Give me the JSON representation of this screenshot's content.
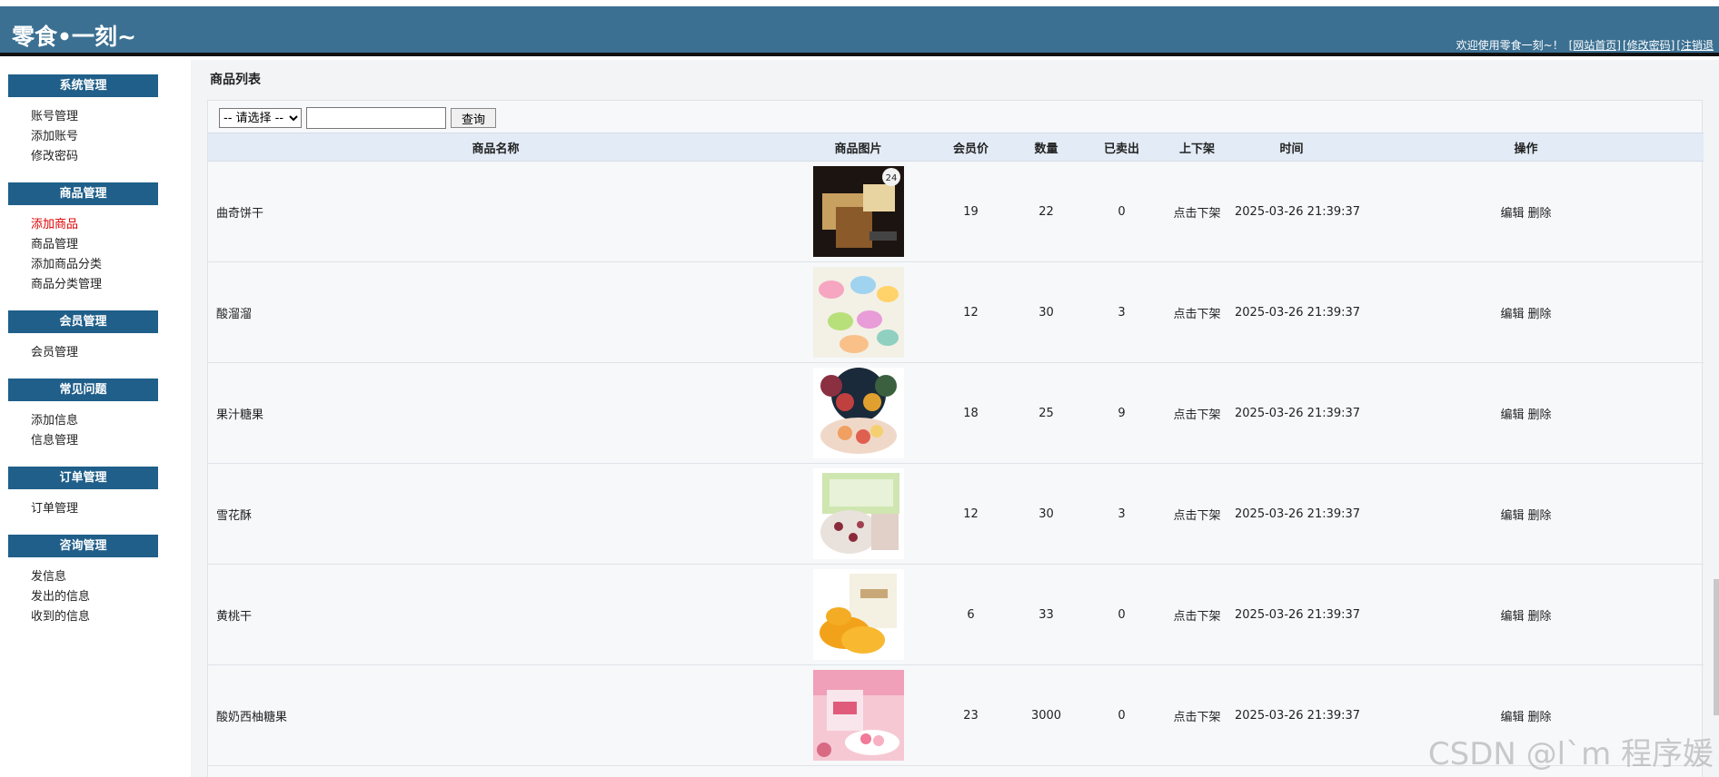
{
  "header": {
    "site_title": "零食•一刻~",
    "welcome": "欢迎使用零食一刻~！",
    "links": [
      "[网站首页]",
      "[修改密码]",
      "[注销退"
    ]
  },
  "sidebar": {
    "groups": [
      {
        "title": "系统管理",
        "items": [
          "账号管理",
          "添加账号",
          "修改密码"
        ]
      },
      {
        "title": "商品管理",
        "items": [
          "添加商品",
          "商品管理",
          "添加商品分类",
          "商品分类管理"
        ]
      },
      {
        "title": "会员管理",
        "items": [
          "会员管理"
        ]
      },
      {
        "title": "常见问题",
        "items": [
          "添加信息",
          "信息管理"
        ]
      },
      {
        "title": "订单管理",
        "items": [
          "订单管理"
        ]
      },
      {
        "title": "咨询管理",
        "items": [
          "发信息",
          "发出的信息",
          "收到的信息"
        ]
      }
    ],
    "active_item": "添加商品"
  },
  "main": {
    "title": "商品列表",
    "search": {
      "select_value": "-- 请选择 --",
      "input_value": "",
      "button_label": "查询"
    },
    "table": {
      "headers": [
        "商品名称",
        "商品图片",
        "会员价",
        "数量",
        "已卖出",
        "上下架",
        "时间",
        "操作"
      ],
      "rows": [
        {
          "name": "曲奇饼干",
          "price": "19",
          "qty": "22",
          "sold": "0",
          "shelf": "点击下架",
          "time": "2025-03-26 21:39:37",
          "edit": "编辑",
          "delete": "删除",
          "image": "cookie-product-image"
        },
        {
          "name": "酸溜溜",
          "price": "12",
          "qty": "30",
          "sold": "3",
          "shelf": "点击下架",
          "time": "2025-03-26 21:39:37",
          "edit": "编辑",
          "delete": "删除",
          "image": "sour-candy-product-image"
        },
        {
          "name": "果汁糖果",
          "price": "18",
          "qty": "25",
          "sold": "9",
          "shelf": "点击下架",
          "time": "2025-03-26 21:39:37",
          "edit": "编辑",
          "delete": "删除",
          "image": "juice-candy-product-image"
        },
        {
          "name": "雪花酥",
          "price": "12",
          "qty": "30",
          "sold": "3",
          "shelf": "点击下架",
          "time": "2025-03-26 21:39:37",
          "edit": "编辑",
          "delete": "删除",
          "image": "snowflake-crisp-product-image"
        },
        {
          "name": "黄桃干",
          "price": "6",
          "qty": "33",
          "sold": "0",
          "shelf": "点击下架",
          "time": "2025-03-26 21:39:37",
          "edit": "编辑",
          "delete": "删除",
          "image": "dried-peach-product-image"
        },
        {
          "name": "酸奶西柚糖果",
          "price": "23",
          "qty": "3000",
          "sold": "0",
          "shelf": "点击下架",
          "time": "2025-03-26 21:39:37",
          "edit": "编辑",
          "delete": "删除",
          "image": "yogurt-grapefruit-candy-product-image"
        }
      ]
    }
  },
  "watermark": "CSDN @l`m 程序媛",
  "colors": {
    "header_bg": "#3b7092",
    "menu_title_bg": "#1f5f8a",
    "active_item": "#e00000",
    "table_header_bg": "#e3ecf6"
  }
}
